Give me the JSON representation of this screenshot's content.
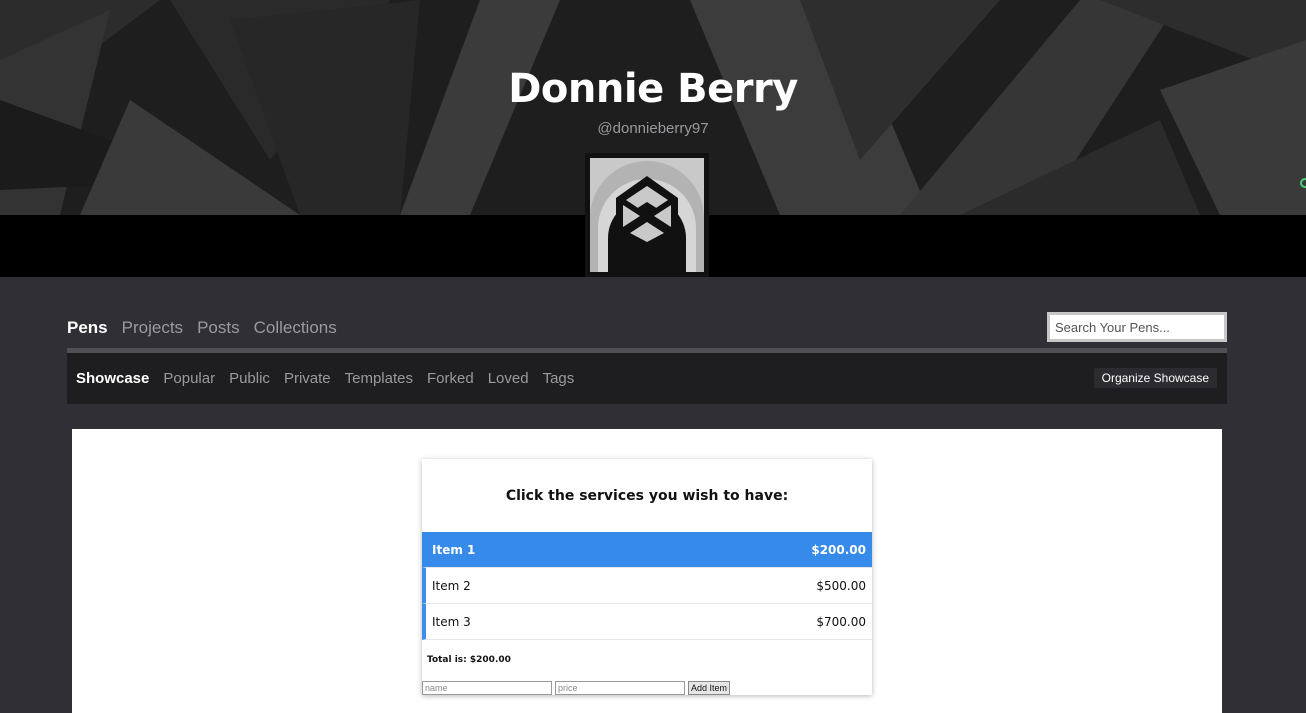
{
  "profile": {
    "name": "Donnie Berry",
    "handle": "@donnieberry97"
  },
  "nav": {
    "main_tabs": [
      {
        "label": "Pens",
        "active": true
      },
      {
        "label": "Projects",
        "active": false
      },
      {
        "label": "Posts",
        "active": false
      },
      {
        "label": "Collections",
        "active": false
      }
    ],
    "search_placeholder": "Search Your Pens...",
    "sub_tabs": [
      {
        "label": "Showcase",
        "active": true
      },
      {
        "label": "Popular",
        "active": false
      },
      {
        "label": "Public",
        "active": false
      },
      {
        "label": "Private",
        "active": false
      },
      {
        "label": "Templates",
        "active": false
      },
      {
        "label": "Forked",
        "active": false
      },
      {
        "label": "Loved",
        "active": false
      },
      {
        "label": "Tags",
        "active": false
      }
    ],
    "organize_label": "Organize Showcase"
  },
  "preview": {
    "title": "Click the services you wish to have:",
    "items": [
      {
        "name": "Item 1",
        "price": "$200.00",
        "selected": true
      },
      {
        "name": "Item 2",
        "price": "$500.00",
        "selected": false
      },
      {
        "name": "Item 3",
        "price": "$700.00",
        "selected": false
      }
    ],
    "total": "Total is: $200.00",
    "name_placeholder": "name",
    "price_placeholder": "price",
    "add_label": "Add Item"
  },
  "colors": {
    "accent": "#368ae9",
    "header_bg": "#1e1e1f",
    "page_bg": "#2f2f35"
  }
}
